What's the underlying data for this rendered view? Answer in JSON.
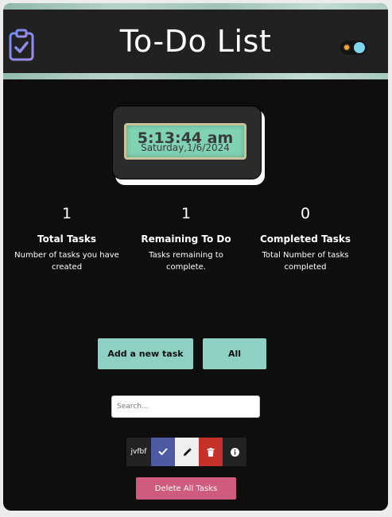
{
  "header": {
    "title": "To-Do List",
    "logo_icon": "clipboard-check-icon",
    "theme_toggle_icon": "sun-icon"
  },
  "clock": {
    "time": "5:13:44 am",
    "date": "Saturday,1/6/2024"
  },
  "stats": [
    {
      "count": "1",
      "label": "Total Tasks",
      "description": "Number of tasks you have created"
    },
    {
      "count": "1",
      "label": "Remaining To Do",
      "description": "Tasks remaining to complete."
    },
    {
      "count": "0",
      "label": "Completed Tasks",
      "description": "Total Number of tasks completed"
    }
  ],
  "actions": {
    "add_label": "Add a new task",
    "filter_label": "All"
  },
  "search": {
    "placeholder": "Search...",
    "value": ""
  },
  "tasks": [
    {
      "name": "jvfbf",
      "complete_icon": "check-icon",
      "edit_icon": "pencil-icon",
      "delete_icon": "trash-icon",
      "info_icon": "info-icon"
    }
  ],
  "delete_all_label": "Delete All Tasks",
  "colors": {
    "background": "#0e0e0e",
    "header": "#212121",
    "accent_teal": "#8fd0c4",
    "complete_blue": "#4e5aa2",
    "delete_red": "#c6312a",
    "delete_all_pink": "#cf5b7e",
    "toggle_blue": "#7fd6ea"
  }
}
